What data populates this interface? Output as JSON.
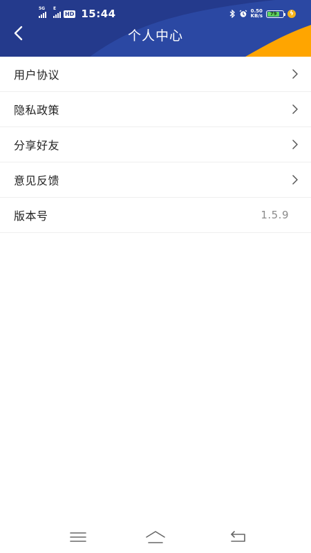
{
  "status_bar": {
    "network_5g": "5G",
    "network_e": "E",
    "hd": "HD",
    "time": "15:44",
    "net_speed_value": "0.50",
    "net_speed_unit": "KB/s",
    "battery_level": "79",
    "icons": [
      "bluetooth-icon",
      "alarm-icon",
      "battery-icon",
      "charging-icon"
    ]
  },
  "header": {
    "title": "个人中心",
    "back_icon": "chevron-left-icon",
    "colors": {
      "primary": "#243a8c",
      "accent": "#ffa500"
    }
  },
  "menu": {
    "items": [
      {
        "label": "用户协议",
        "icon": "chevron-right-icon"
      },
      {
        "label": "隐私政策",
        "icon": "chevron-right-icon"
      },
      {
        "label": "分享好友",
        "icon": "chevron-right-icon"
      },
      {
        "label": "意见反馈",
        "icon": "chevron-right-icon"
      },
      {
        "label": "版本号",
        "value": "1.5.9"
      }
    ]
  },
  "nav_bar": {
    "icons": [
      "menu-icon",
      "home-icon",
      "back-icon"
    ]
  }
}
